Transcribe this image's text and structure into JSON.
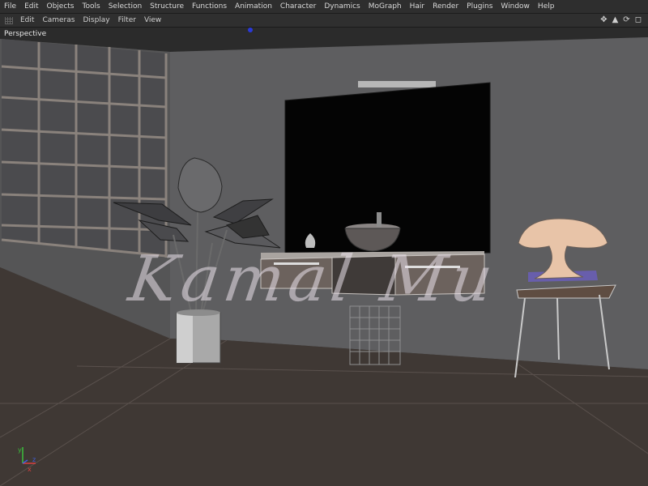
{
  "menu": {
    "items": [
      "File",
      "Edit",
      "Objects",
      "Tools",
      "Selection",
      "Structure",
      "Functions",
      "Animation",
      "Character",
      "Dynamics",
      "MoGraph",
      "Hair",
      "Render",
      "Plugins",
      "Window",
      "Help"
    ]
  },
  "view_menu": {
    "items": [
      "Edit",
      "Cameras",
      "Display",
      "Filter",
      "View"
    ]
  },
  "viewport": {
    "label": "Perspective",
    "watermark": "Kamal Mu"
  },
  "axis": {
    "x": "x",
    "y": "y",
    "z": "z"
  },
  "colors": {
    "menu_bg": "#2e2e2e",
    "wall": "#5e5e60",
    "floor": "#3f3834",
    "ceiling": "#2b2b2b",
    "tv": "#040404",
    "accent_selection": "#6f5fe0"
  },
  "icons": [
    "move-icon",
    "zoom-icon",
    "rotate-icon",
    "maximize-icon"
  ]
}
